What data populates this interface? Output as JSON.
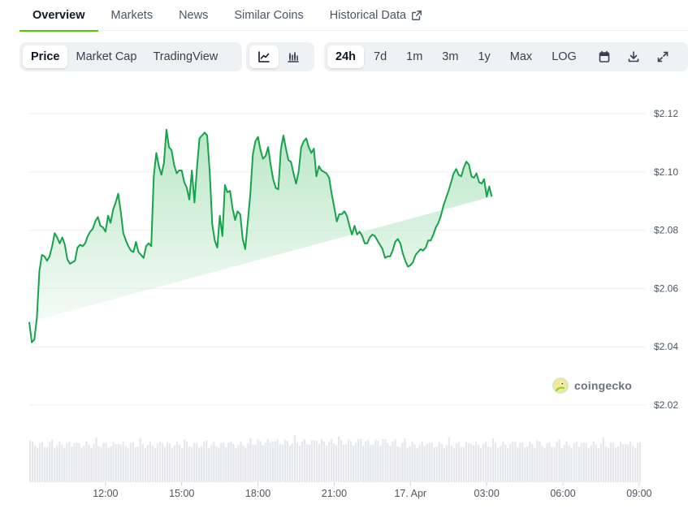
{
  "tabs": [
    {
      "label": "Overview",
      "active": true
    },
    {
      "label": "Markets"
    },
    {
      "label": "News"
    },
    {
      "label": "Similar Coins"
    },
    {
      "label": "Historical Data",
      "icon": "external-link-icon"
    }
  ],
  "toolbar": {
    "view_modes": [
      {
        "label": "Price",
        "selected": true
      },
      {
        "label": "Market Cap"
      },
      {
        "label": "TradingView"
      }
    ],
    "chart_styles": [
      {
        "icon": "line-chart-icon",
        "selected": true
      },
      {
        "icon": "candlestick-chart-icon"
      }
    ],
    "ranges": [
      {
        "label": "24h",
        "selected": true
      },
      {
        "label": "7d"
      },
      {
        "label": "1m"
      },
      {
        "label": "3m"
      },
      {
        "label": "1y"
      },
      {
        "label": "Max"
      },
      {
        "label": "LOG"
      }
    ],
    "actions": [
      {
        "icon": "calendar-icon"
      },
      {
        "icon": "download-icon"
      },
      {
        "icon": "fullscreen-icon"
      }
    ]
  },
  "watermark": "coingecko",
  "colors": {
    "line": "#16a34a",
    "fill_top": "#b7e6c4",
    "accent": "#4bcc00",
    "volume": "#e5e7eb"
  },
  "chart_data": {
    "type": "area",
    "title": "",
    "xlabel": "",
    "ylabel": "",
    "ylim": [
      2.015,
      2.125
    ],
    "yticks": [
      "$2.12",
      "$2.10",
      "$2.08",
      "$2.06",
      "$2.04",
      "$2.02"
    ],
    "ytick_values": [
      2.12,
      2.1,
      2.08,
      2.06,
      2.04,
      2.02
    ],
    "xticks": [
      "12:00",
      "15:00",
      "18:00",
      "21:00",
      "17. Apr",
      "03:00",
      "06:00",
      "09:00"
    ],
    "xtick_hours": [
      3,
      6,
      9,
      12,
      15,
      18,
      21,
      24
    ],
    "x_range_hours": [
      0,
      24.1
    ],
    "grid": true,
    "series": [
      {
        "hours": [
          0.0,
          0.1,
          0.2,
          0.3,
          0.4,
          0.5,
          0.6,
          0.7,
          0.8,
          0.9,
          1.0,
          1.1,
          1.2,
          1.3,
          1.4,
          1.5,
          1.6,
          1.7,
          1.8,
          1.9,
          2.0,
          2.1,
          2.2,
          2.3,
          2.4,
          2.5,
          2.6,
          2.7,
          2.8,
          2.9,
          3.0,
          3.1,
          3.2,
          3.3,
          3.4,
          3.5,
          3.6,
          3.7,
          3.8,
          3.9,
          4.0,
          4.1,
          4.2,
          4.3,
          4.4,
          4.5,
          4.6,
          4.7,
          4.8,
          4.9,
          5.0,
          5.1,
          5.2,
          5.3,
          5.4,
          5.5,
          5.6,
          5.7,
          5.8,
          5.9,
          6.0,
          6.1,
          6.2,
          6.3,
          6.4,
          6.5,
          6.6,
          6.7,
          6.8,
          6.9,
          7.0,
          7.1,
          7.2,
          7.3,
          7.4,
          7.5,
          7.6,
          7.7,
          7.8,
          7.9,
          8.0,
          8.1,
          8.2,
          8.3,
          8.4,
          8.5,
          8.6,
          8.7,
          8.8,
          8.9,
          9.0,
          9.1,
          9.2,
          9.3,
          9.4,
          9.5,
          9.6,
          9.7,
          9.8,
          9.9,
          10.0,
          10.1,
          10.2,
          10.3,
          10.4,
          10.5,
          10.6,
          10.7,
          10.8,
          10.9,
          11.0,
          11.1,
          11.2,
          11.3,
          11.4,
          11.5,
          11.6,
          11.7,
          11.8,
          11.9,
          12.0,
          12.1,
          12.2,
          12.3,
          12.4,
          12.5,
          12.6,
          12.7,
          12.8,
          12.9,
          13.0,
          13.1,
          13.2,
          13.3,
          13.4,
          13.5,
          13.6,
          13.7,
          13.8,
          13.9,
          14.0,
          14.1,
          14.2,
          14.3,
          14.4,
          14.5,
          14.6,
          14.7,
          14.8,
          14.9,
          15.0,
          15.1,
          15.2,
          15.3,
          15.4,
          15.5,
          15.6,
          15.7,
          15.8,
          15.9,
          16.0,
          16.1,
          16.2,
          16.3,
          16.4,
          16.5,
          16.6,
          16.7,
          16.8,
          16.9,
          17.0,
          17.1,
          17.2,
          17.3,
          17.4,
          17.5,
          17.6,
          17.7,
          17.8,
          17.9,
          18.0,
          18.1,
          18.2,
          18.3,
          18.4,
          18.5,
          18.6,
          18.7,
          18.8,
          18.9,
          19.0,
          19.1,
          19.2,
          19.3,
          19.4,
          19.5,
          19.6,
          19.7,
          19.8,
          19.9,
          20.0,
          20.1,
          20.2,
          20.3,
          20.4,
          20.5,
          20.6,
          20.7,
          20.8,
          20.9,
          21.0,
          21.1,
          21.2,
          21.3,
          21.4,
          21.5,
          21.6,
          21.7,
          21.8,
          21.9,
          22.0,
          22.1,
          22.2,
          22.3,
          22.4,
          22.5,
          22.6,
          22.7,
          22.8,
          22.9,
          23.0,
          23.1,
          23.2,
          23.3,
          23.4,
          23.5,
          23.6,
          23.7,
          23.8,
          23.9,
          24.0,
          24.1
        ],
        "values": [
          2.0485,
          2.0415,
          2.0425,
          2.05,
          2.066,
          2.0715,
          2.071,
          2.0695,
          2.071,
          2.0745,
          2.079,
          2.0775,
          2.0755,
          2.0775,
          2.075,
          2.07,
          2.0685,
          2.069,
          2.0695,
          2.074,
          2.075,
          2.0745,
          2.0755,
          2.078,
          2.0795,
          2.0805,
          2.083,
          2.0845,
          2.0815,
          2.081,
          2.0795,
          2.085,
          2.0825,
          2.087,
          2.0895,
          2.0925,
          2.0865,
          2.079,
          2.0765,
          2.0745,
          2.073,
          2.0725,
          2.076,
          2.0725,
          2.0715,
          2.0705,
          2.0745,
          2.0755,
          2.0745,
          2.0985,
          2.1065,
          2.102,
          2.099,
          2.103,
          2.1145,
          2.1085,
          2.1075,
          2.1025,
          2.0995,
          2.1005,
          2.1005,
          2.0965,
          2.0945,
          2.0905,
          2.1005,
          2.0895,
          2.1015,
          2.1115,
          2.1125,
          2.1135,
          2.1125,
          2.1005,
          2.082,
          2.0765,
          2.074,
          2.085,
          2.078,
          2.0955,
          2.093,
          2.0935,
          2.0875,
          2.0835,
          2.0865,
          2.0855,
          2.077,
          2.0735,
          2.083,
          2.0925,
          2.106,
          2.1105,
          2.112,
          2.1075,
          2.1045,
          2.1055,
          2.1085,
          2.1025,
          2.0975,
          2.0945,
          2.094,
          2.1075,
          2.1125,
          2.108,
          2.104,
          2.1035,
          2.0995,
          2.096,
          2.1,
          2.1085,
          2.1105,
          2.1115,
          2.1085,
          2.1065,
          2.108,
          2.0985,
          2.102,
          2.1005,
          2.1,
          2.0995,
          2.098,
          2.0925,
          2.088,
          2.083,
          2.0855,
          2.0855,
          2.0865,
          2.085,
          2.0815,
          2.0785,
          2.0815,
          2.0785,
          2.0795,
          2.078,
          2.0755,
          2.0755,
          2.0775,
          2.0785,
          2.078,
          2.0765,
          2.075,
          2.0735,
          2.0705,
          2.071,
          2.071,
          2.073,
          2.076,
          2.077,
          2.0755,
          2.072,
          2.0695,
          2.0675,
          2.068,
          2.069,
          2.0715,
          2.0725,
          2.0735,
          2.073,
          2.074,
          2.0765,
          2.0765,
          2.0785,
          2.081,
          2.0825,
          2.085,
          2.0885,
          2.091,
          2.0935,
          2.0965,
          2.0995,
          2.101,
          2.099,
          2.0985,
          2.1015,
          2.1035,
          2.1025,
          2.0985,
          2.098,
          2.0995,
          2.0965,
          2.096,
          2.0975,
          2.0915,
          2.095,
          2.0915
        ],
        "visible_range_note": ""
      }
    ]
  }
}
